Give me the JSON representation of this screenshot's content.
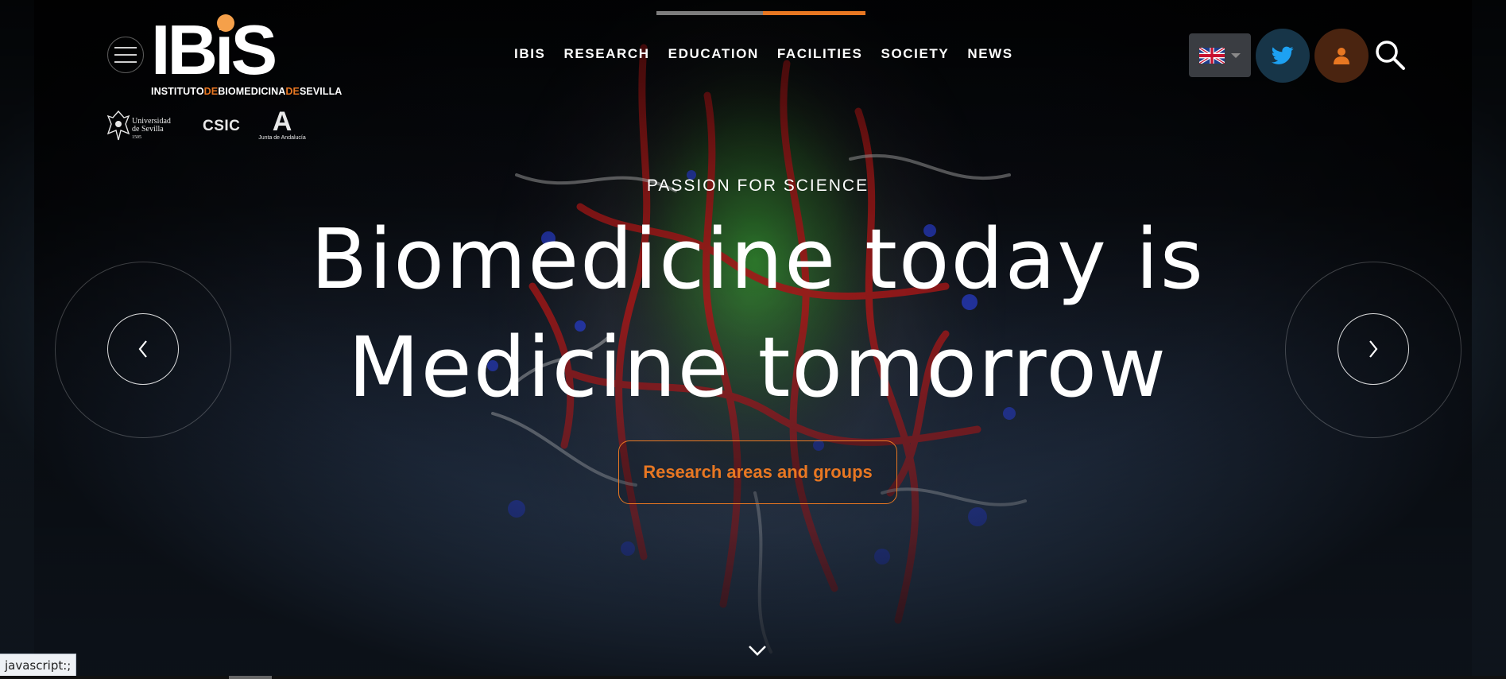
{
  "brand": {
    "logo_word": "IBiS",
    "logo_sub_parts": [
      "INSTITUTO",
      "DE",
      "BIOMEDICINA",
      "DE",
      "SEVILLA"
    ],
    "accent_color": "#e87722",
    "partners": {
      "us_line1": "Universidad",
      "us_line2": "de Sevilla",
      "us_year": "1505",
      "csic": "CSIC",
      "junta_letter": "A",
      "junta": "Junta de Andalucía"
    }
  },
  "nav": {
    "items": [
      "IBIS",
      "RESEARCH",
      "EDUCATION",
      "FACILITIES",
      "SOCIETY",
      "NEWS"
    ]
  },
  "header_icons": {
    "language": "uk-flag-icon",
    "twitter": "twitter-icon",
    "user": "user-icon",
    "search": "search-icon"
  },
  "hero": {
    "eyebrow": "PASSION FOR SCIENCE",
    "headline": "Biomedicine today is Medicine tomorrow",
    "cta": "Research areas and groups",
    "slide_progress": 0.49
  },
  "status_bar": {
    "text": "javascript:;"
  }
}
